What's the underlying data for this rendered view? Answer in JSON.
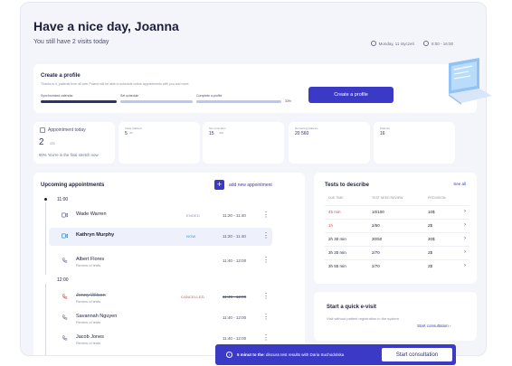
{
  "header": {
    "greeting": "Have a nice day, Joanna",
    "visits_text": "You still have 2 visits today",
    "date": "Monday, 11 styczeń",
    "time": "8:00 - 16:00"
  },
  "profile": {
    "title": "Create a profile",
    "description": "Thanks to it, patients from all over Poland will be able to schedule online appointments with you and more.",
    "steps": [
      {
        "label": "Synchronised calendar"
      },
      {
        "label": "Set schedule"
      },
      {
        "label": "Complete a profile"
      }
    ],
    "progress_text": "33%",
    "button": "Create a profile"
  },
  "stats": {
    "appointment_today": {
      "label": "Appointment today",
      "value": "2",
      "total": "/25",
      "note": "90% You're in the final stretch now"
    },
    "cards": [
      {
        "label": "Visits realized",
        "value": "5",
        "sub": "/40"
      },
      {
        "label": "Set reminders",
        "value": "15",
        "sub": "/100"
      },
      {
        "label": "Remaining balance",
        "value": "20 560",
        "sub": ""
      },
      {
        "label": "Patients",
        "value": "16",
        "sub": ""
      }
    ]
  },
  "upcoming": {
    "title": "Upcoming appointments",
    "add_label": "add new appointment",
    "groups": [
      {
        "time": "11:00",
        "items": [
          {
            "name": "Wade Warren",
            "sub": "",
            "status": "ENDED",
            "time": "11:20 - 11:40",
            "type": "video"
          },
          {
            "name": "Kathryn Murphy",
            "sub": "",
            "status": "NOW",
            "time": "11:20 - 11:40",
            "type": "video"
          },
          {
            "name": "Albert Flores",
            "sub": "Review of tests",
            "status": "",
            "time": "11:40 - 12:00",
            "type": "phone"
          }
        ]
      },
      {
        "time": "12:00",
        "items": [
          {
            "name": "Jenny Wilson",
            "sub": "Review of tests",
            "status": "CANCELLED",
            "time": "11:40 - 12:00",
            "type": "phone-red"
          },
          {
            "name": "Savannah Nguyen",
            "sub": "Review of tests",
            "status": "",
            "time": "11:40 - 12:00",
            "type": "phone"
          },
          {
            "name": "Jacob Jones",
            "sub": "Review of tests",
            "status": "",
            "time": "11:40 - 12:00",
            "type": "phone"
          }
        ]
      }
    ]
  },
  "tests": {
    "title": "Tests to describe",
    "see_all": "See all",
    "columns": [
      "DUE TIME",
      "TEST NEED REVIEW",
      "PROVISION"
    ],
    "rows": [
      {
        "due": "45 min",
        "need": "10/100",
        "prov": "10$",
        "red": true
      },
      {
        "due": "1h",
        "need": "2/50",
        "prov": "2$",
        "red": true
      },
      {
        "due": "2h 30 min",
        "need": "30/50",
        "prov": "30$",
        "red": false
      },
      {
        "due": "3h 30 min",
        "need": "2/70",
        "prov": "2$",
        "red": false
      },
      {
        "due": "3h 55 min",
        "need": "2/70",
        "prov": "2$",
        "red": false
      }
    ]
  },
  "evisit": {
    "title": "Start a quick e-visit",
    "description": "Visit without patient registration in the system",
    "link": "Start consultation"
  },
  "banner": {
    "bold": "5 minut to the",
    "text": ": discuss test results with Daria Suchodolska",
    "button": "Start consultation"
  },
  "colors": {
    "accent": "#3b3ac7",
    "danger": "#d64a4a",
    "background": "#f4f5fb"
  }
}
